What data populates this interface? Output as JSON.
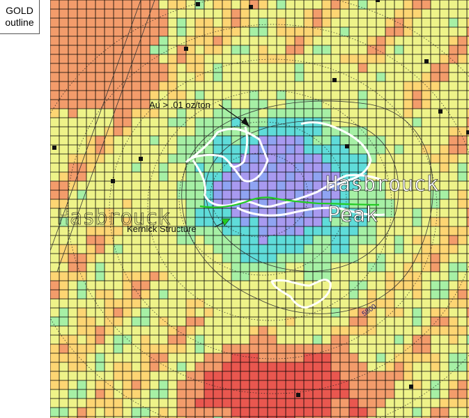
{
  "legend": {
    "line1": "GOLD",
    "line2": "outline"
  },
  "map": {
    "annotations": {
      "au_threshold": "Au > .01 oz/ton",
      "structure": "Kernick Structure",
      "peak_name_1": "Hasbrouck",
      "peak_name_2": "Peak",
      "peak_ghost": "Hasbrouck",
      "contour_label": "5800"
    },
    "colors": {
      "high": "#e9574f",
      "med_high": "#f39c6b",
      "medium": "#fdd573",
      "low": "#eef389",
      "lower": "#a6f0a5",
      "very_low": "#5fdcd9",
      "min_a": "#8fa4f2",
      "min_b": "#a89af0",
      "gold_outline": "#ffffff",
      "structure_line": "#22cc22",
      "grid": "#000000"
    }
  }
}
